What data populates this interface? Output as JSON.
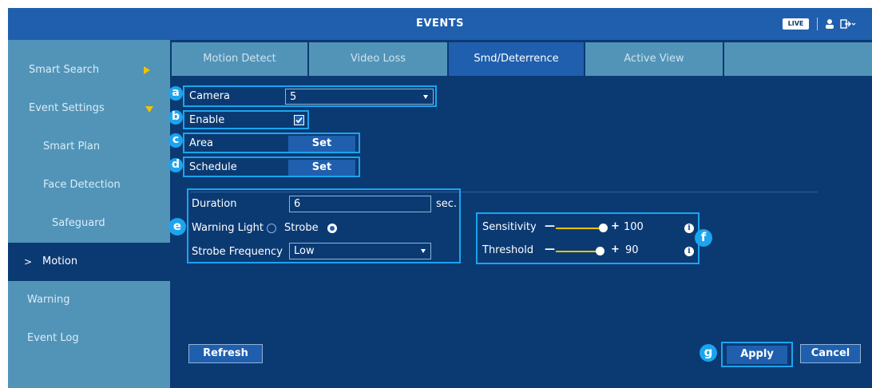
{
  "header": {
    "title": "EVENTS",
    "live_label": "LIVE"
  },
  "sidebar": {
    "items": [
      {
        "label": "Smart Search"
      },
      {
        "label": "Event Settings"
      },
      {
        "label": "Smart Plan"
      },
      {
        "label": "Face Detection"
      },
      {
        "label": "Safeguard"
      },
      {
        "label": "Motion",
        "prefix": ">"
      },
      {
        "label": "Warning"
      },
      {
        "label": "Event Log"
      }
    ]
  },
  "tabs": [
    {
      "label": "Motion Detect"
    },
    {
      "label": "Video Loss"
    },
    {
      "label": "Smd/Deterrence"
    },
    {
      "label": "Active View"
    }
  ],
  "form": {
    "camera": {
      "label": "Camera",
      "value": "5"
    },
    "enable": {
      "label": "Enable",
      "checked": true
    },
    "area": {
      "label": "Area",
      "button": "Set"
    },
    "schedule": {
      "label": "Schedule",
      "button": "Set"
    },
    "duration": {
      "label": "Duration",
      "value": "6",
      "unit": "sec."
    },
    "warning_light": {
      "label": "Warning Light",
      "strobe_label": "Strobe",
      "warning_selected": false,
      "strobe_selected": true
    },
    "strobe_frequency": {
      "label": "Strobe Frequency",
      "value": "Low"
    },
    "sensitivity": {
      "label": "Sensitivity",
      "minus": "—",
      "plus": "+",
      "value": "100"
    },
    "threshold": {
      "label": "Threshold",
      "minus": "—",
      "plus": "+",
      "value": "90"
    }
  },
  "callouts": {
    "a": "a",
    "b": "b",
    "c": "c",
    "d": "d",
    "e": "e",
    "f": "f",
    "g": "g"
  },
  "buttons": {
    "refresh": "Refresh",
    "apply": "Apply",
    "cancel": "Cancel"
  },
  "icons": {
    "user": "user-icon",
    "logout": "logout-icon",
    "info": "info-icon",
    "check": "check-icon",
    "chevron_right": "chevron-right-icon",
    "chevron_down": "chevron-down-icon"
  },
  "colors": {
    "background": "#0b3a73",
    "title_bar": "#1f5fae",
    "sidebar": "#5294b8",
    "highlight": "#1ca4ee",
    "accent": "#f2c200"
  }
}
